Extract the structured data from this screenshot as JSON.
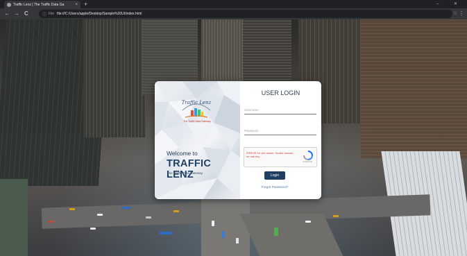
{
  "browser": {
    "tab_title": "Traffic Lenz | The Traffic Data Ga",
    "tab_close": "×",
    "new_tab": "+",
    "window_controls": "–  ✕",
    "back": "←",
    "forward": "→",
    "reload": "C",
    "scheme": "File",
    "url": "file:///C:/Users/apple/Desktop/Sample%20UI/index.html",
    "star": "☆",
    "menu": "⋮"
  },
  "brand": {
    "logo_text": "Traffic Lenz",
    "logo_tagline": "The Traffic Data Gateway",
    "welcome": "Welcome to",
    "name": "TRAFFIC LENZ",
    "tagline": "The Traffic Data Gateway"
  },
  "login": {
    "title": "USER LOGIN",
    "username_placeholder": "Username",
    "password_placeholder": "Password",
    "captcha_error": "ERROR for site owner: Invalid domain for site key",
    "captcha_brand": "reCAPTCHA",
    "button": "Login",
    "forgot": "Forgot Password?"
  },
  "colors": {
    "brand_navy": "#1f3f62",
    "error_red": "#e0403a",
    "link_blue": "#4a78a8"
  }
}
